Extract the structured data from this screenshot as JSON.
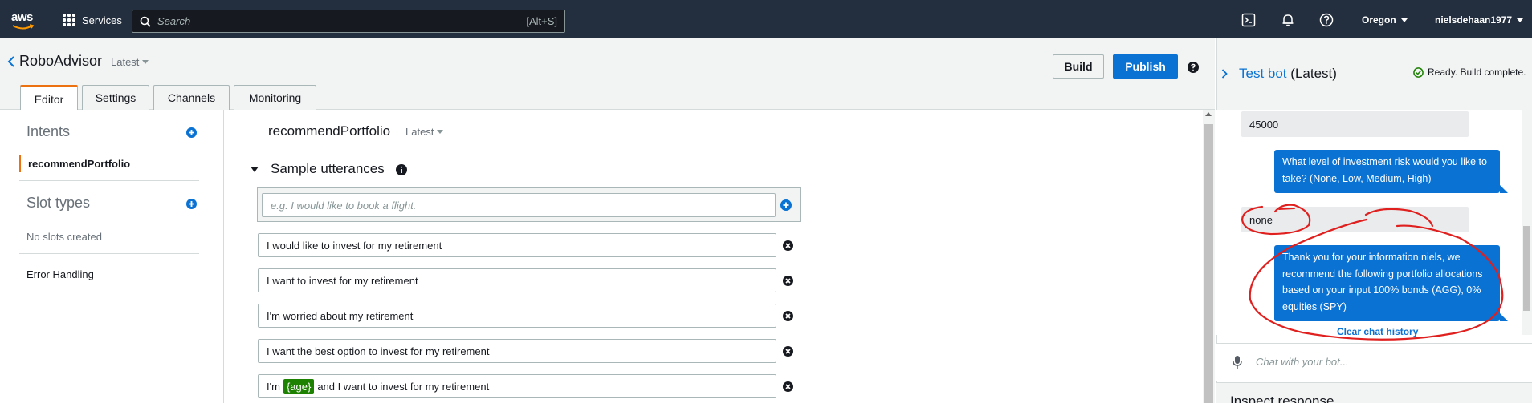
{
  "topnav": {
    "logo_text": "aws",
    "services_label": "Services",
    "search_placeholder": "Search",
    "search_shortcut": "[Alt+S]",
    "region": "Oregon",
    "account": "nielsdehaan1977",
    "icons": [
      "cloudshell-icon",
      "bell-icon",
      "help-icon"
    ]
  },
  "bot": {
    "name": "RoboAdvisor",
    "version": "Latest",
    "build_label": "Build",
    "publish_label": "Publish"
  },
  "tabs": [
    {
      "label": "Editor",
      "active": true
    },
    {
      "label": "Settings",
      "active": false
    },
    {
      "label": "Channels",
      "active": false
    },
    {
      "label": "Monitoring",
      "active": false
    }
  ],
  "sidebar": {
    "intents_heading": "Intents",
    "intents": [
      "recommendPortfolio"
    ],
    "slot_types_heading": "Slot types",
    "no_slots": "No slots created",
    "error_handling": "Error Handling"
  },
  "intent": {
    "name": "recommendPortfolio",
    "version": "Latest",
    "section_title": "Sample utterances",
    "new_placeholder": "e.g. I would like to book a flight.",
    "utterances": [
      "I would like to invest for my retirement",
      "I want to invest for my retirement",
      "I'm worried about my retirement",
      "I want the best option to invest for my retirement"
    ],
    "slot_utterance": {
      "before": "I'm",
      "slot": "{age}",
      "after": "and I want to invest for my retirement"
    }
  },
  "testbot": {
    "title_link": "Test bot",
    "title_suffix": "(Latest)",
    "status": "Ready. Build complete.",
    "messages": [
      {
        "from": "user",
        "text": "45000"
      },
      {
        "from": "bot",
        "text": "What level of investment risk would you like to take? (None, Low, Medium, High)"
      },
      {
        "from": "user",
        "text": "none"
      },
      {
        "from": "bot",
        "text": "Thank you for your information niels, we recommend the following portfolio allocations based on your input 100% bonds (AGG), 0% equities (SPY)"
      }
    ],
    "clear_history": "Clear chat history",
    "input_placeholder": "Chat with your bot...",
    "inspect_title": "Inspect response"
  },
  "colors": {
    "nav_bg": "#232f3e",
    "accent_orange": "#ec7211",
    "primary_blue": "#0972d3",
    "slot_green": "#1d8102",
    "annotation_red": "#e0201f"
  }
}
